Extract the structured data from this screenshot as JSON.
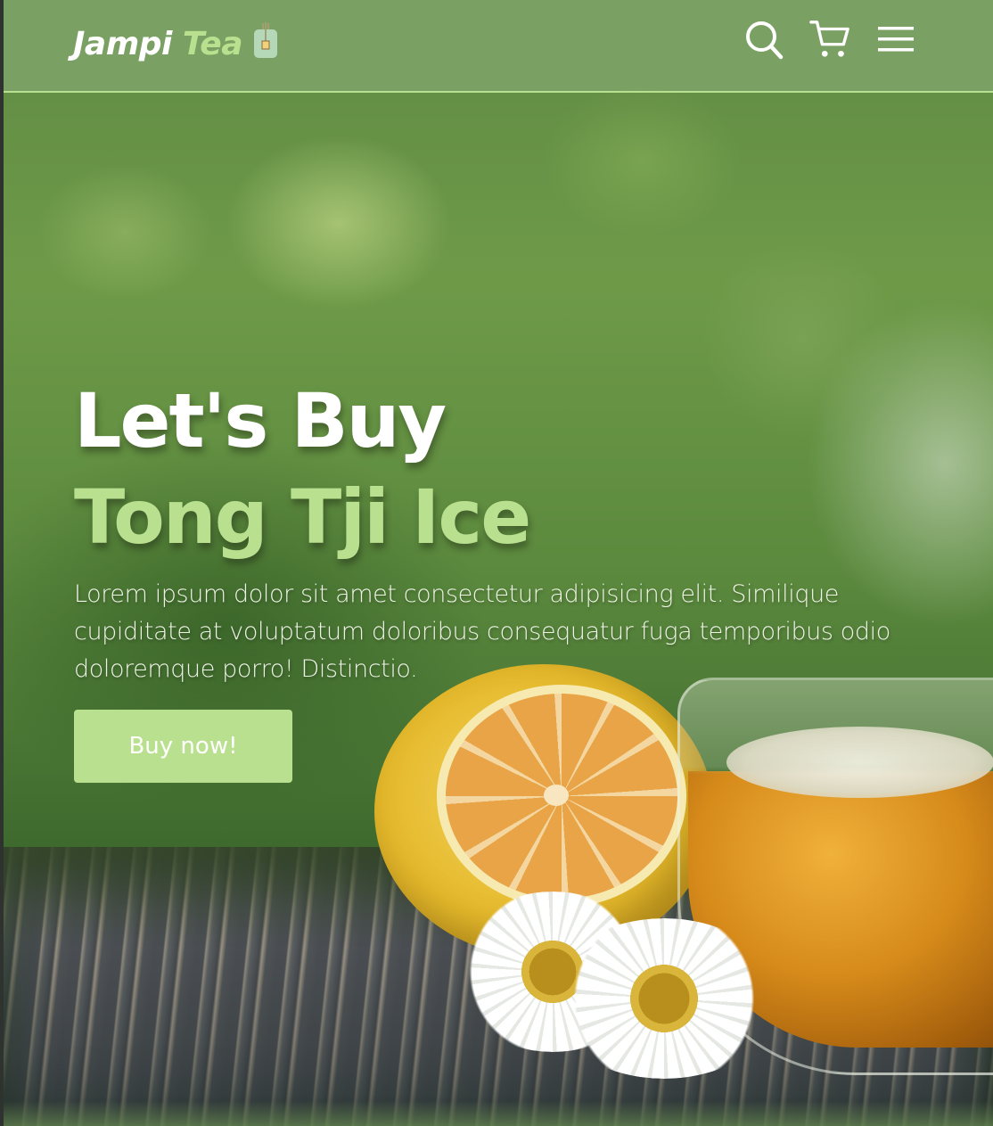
{
  "header": {
    "logo": {
      "primary": "Jampi",
      "accent": "Tea",
      "icon": "tea-bag-icon"
    },
    "icons": {
      "search": "search-icon",
      "cart": "cart-icon",
      "menu": "hamburger-menu-icon"
    }
  },
  "hero": {
    "title_line1": "Let's Buy",
    "title_line2": "Tong Tji Ice",
    "description": "Lorem ipsum dolor sit amet consectetur adipisicing elit. Similique cupiditate at voluptatum doloribus consequatur fuga temporibus odio doloremque porro! Distinctio.",
    "cta_label": "Buy now!"
  },
  "colors": {
    "accent": "#b9e08e",
    "header_bg": "#7ea368",
    "text_light": "#ffffff"
  }
}
